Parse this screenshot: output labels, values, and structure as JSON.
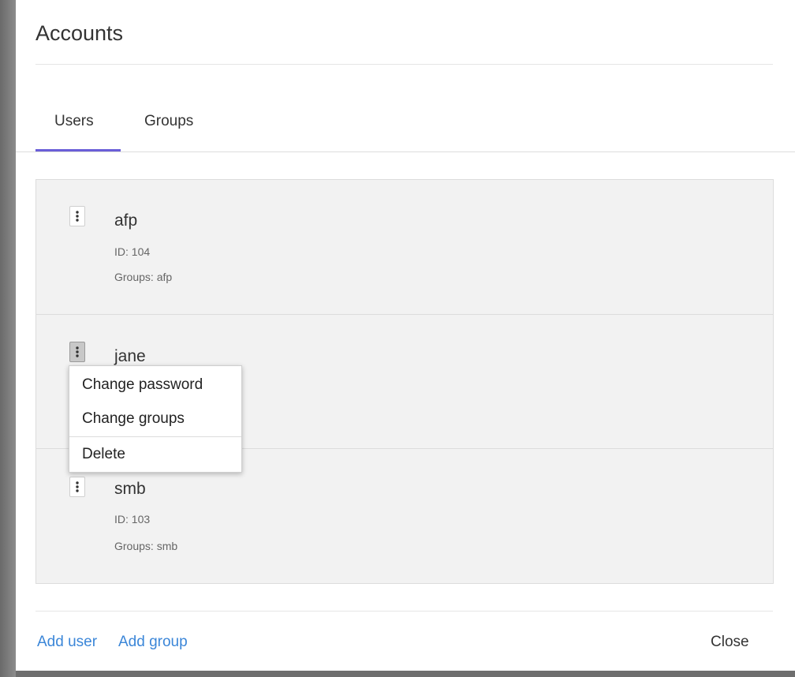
{
  "dialog": {
    "title": "Accounts"
  },
  "tabs": [
    {
      "label": "Users",
      "active": true
    },
    {
      "label": "Groups",
      "active": false
    }
  ],
  "users": [
    {
      "name": "afp",
      "id": "ID: 104",
      "groups": "Groups: afp"
    },
    {
      "name": "jane"
    },
    {
      "name": "smb",
      "id": "ID: 103",
      "groups": "Groups: smb"
    }
  ],
  "context_menu": {
    "items": [
      {
        "label": "Change password"
      },
      {
        "label": "Change groups"
      },
      {
        "label": "Delete"
      }
    ]
  },
  "footer": {
    "add_user": "Add user",
    "add_group": "Add group",
    "close": "Close"
  },
  "colors": {
    "tab_indicator": "#6a5ed8",
    "link": "#3b86d8",
    "list_background": "#f2f2f2"
  },
  "icons": {
    "kebab": "more-vertical-icon"
  }
}
